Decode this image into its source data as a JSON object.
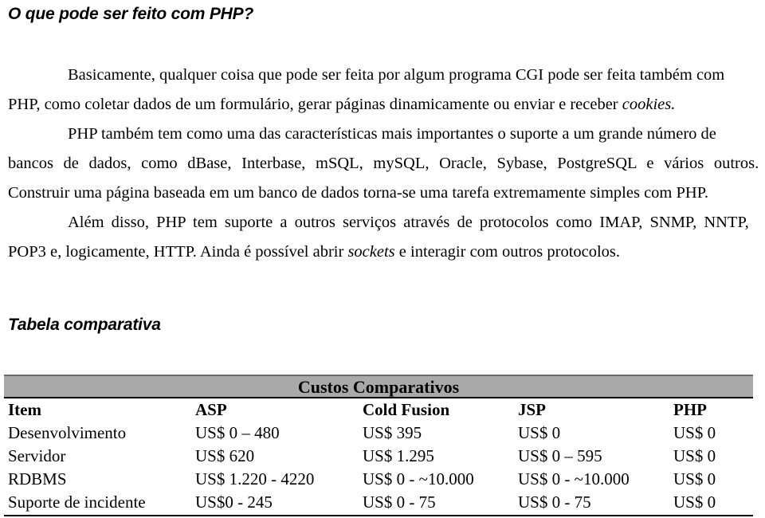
{
  "document": {
    "title": "O que pode ser feito com PHP?",
    "paragraphs": [
      {
        "lines": [
          "Basicamente, qualquer coisa que pode ser feita por algum programa CGI pode ser feita também com",
          "PHP, como coletar dados de um formulário, gerar páginas dinamicamente ou enviar e receber "
        ],
        "italic_tail": "cookies."
      },
      {
        "lines": [
          "PHP também tem como uma das características mais importantes o suporte a um grande número de",
          "bancos de dados, como dBase, Interbase, mSQL, mySQL, Oracle, Sybase, PostgreSQL e vários outros."
        ]
      },
      {
        "lines": [
          "Construir uma página baseada em um banco de dados torna-se uma tarefa extremamente simples com PHP."
        ]
      },
      {
        "lines": [
          "Além disso, PHP tem suporte a outros serviços através de protocolos como IMAP, SNMP, NNTP,",
          "POP3 e, logicamente, HTTP. Ainda é possível abrir "
        ],
        "italic_mid": "sockets",
        "line2_tail": " e interagir com outros protocolos."
      }
    ],
    "table_heading": "Tabela comparativa"
  },
  "table": {
    "banner": "Custos Comparativos",
    "columns": [
      "Item",
      "ASP",
      "Cold Fusion",
      "JSP",
      "PHP"
    ],
    "rows": [
      {
        "item": "Desenvolvimento",
        "asp": "US$ 0 – 480",
        "cold_fusion": "US$ 395",
        "jsp": "US$ 0",
        "php": "US$ 0"
      },
      {
        "item": "Servidor",
        "asp": "US$ 620",
        "cold_fusion": "US$ 1.295",
        "jsp": "US$ 0 – 595",
        "php": "US$ 0"
      },
      {
        "item": "RDBMS",
        "asp": "US$ 1.220 - 4220",
        "cold_fusion": "US$ 0 - ~10.000",
        "jsp": "US$ 0 - ~10.000",
        "php": "US$ 0"
      },
      {
        "item": "Suporte de incidente",
        "asp": "US$0 - 245",
        "cold_fusion": "US$ 0 - 75",
        "jsp": "US$ 0 - 75",
        "php": "US$ 0"
      }
    ]
  },
  "colors": {
    "banner_background": "#a9a9a9",
    "banner_border": "#6b6b6b",
    "text": "#000000",
    "page_background": "#ffffff"
  }
}
